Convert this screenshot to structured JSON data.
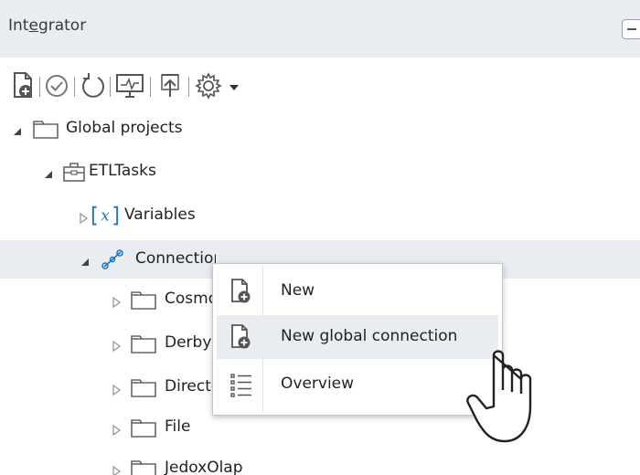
{
  "panel": {
    "title_prefix": "Int",
    "title_underlined": "e",
    "title_suffix": "grator"
  },
  "toolbar": {
    "icons": [
      "new-document-icon",
      "check-circle-icon",
      "refresh-icon",
      "monitor-icon",
      "upload-icon",
      "gear-icon",
      "dropdown-arrow-icon"
    ]
  },
  "tree": {
    "global_projects": "Global projects",
    "etl_tasks": "ETLTasks",
    "variables": "Variables",
    "connections": "Connections",
    "connections_visible": "Connections",
    "cosmos": "Cosmos",
    "derby": "Derby",
    "directory": "Directory",
    "file": "File",
    "jedox_olap": "JedoxOlap"
  },
  "context_menu": {
    "new": "New",
    "new_global_connection": "New global connection",
    "overview": "Overview"
  },
  "colors": {
    "header_bg": "#e9edf2",
    "selection_bg": "#e9edf2",
    "accent_blue": "#1a73c8"
  }
}
